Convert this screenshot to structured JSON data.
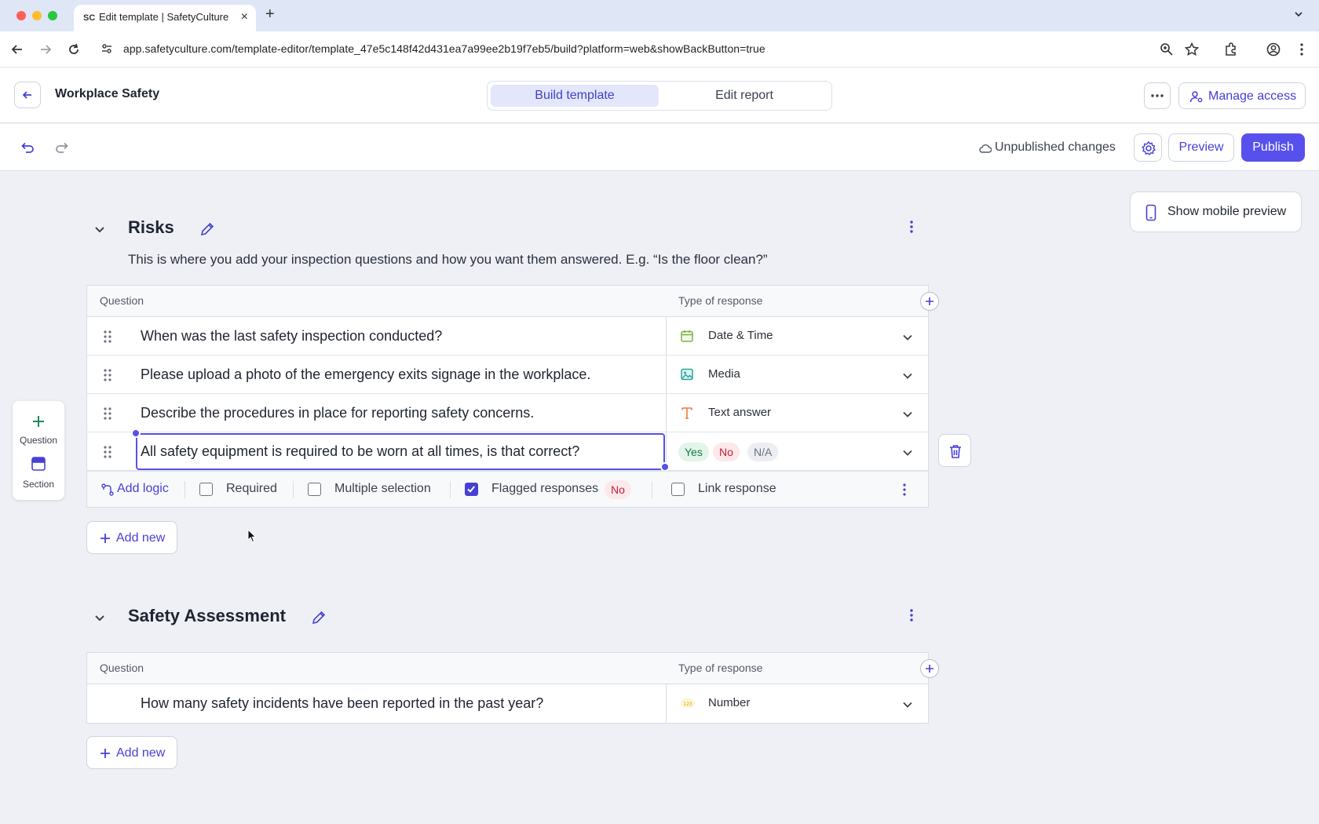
{
  "browser": {
    "tab_title": "Edit template | SafetyCulture",
    "tab_favicon": "SC",
    "url": "app.safetyculture.com/template-editor/template_47e5c148f42d431ea7a99ee2b19f7eb5/build?platform=web&showBackButton=true"
  },
  "header": {
    "title": "Workplace Safety",
    "tabs": [
      {
        "label": "Build template",
        "active": true
      },
      {
        "label": "Edit report",
        "active": false
      }
    ],
    "manage_access_label": "Manage access"
  },
  "toolbar": {
    "status": "Unpublished changes",
    "preview_label": "Preview",
    "publish_label": "Publish"
  },
  "canvas": {
    "mobile_preview_label": "Show mobile preview",
    "add_panel": {
      "question_label": "Question",
      "section_label": "Section"
    }
  },
  "sections": [
    {
      "title": "Risks",
      "description": "This is where you add your inspection questions and how you want them answered. E.g. “Is the floor clean?”",
      "columns": {
        "question": "Question",
        "response": "Type of response"
      },
      "questions": [
        {
          "text": "When was the last safety inspection conducted?",
          "response_type": "Date & Time",
          "icon": "calendar-icon"
        },
        {
          "text": "Please upload a photo of the emergency exits signage in the workplace.",
          "response_type": "Media",
          "icon": "image-icon"
        },
        {
          "text": "Describe the procedures in place for reporting safety concerns.",
          "response_type": "Text answer",
          "icon": "text-icon"
        },
        {
          "text": "All safety equipment is required to be worn at all times, is that correct?",
          "responses": [
            "Yes",
            "No",
            "N/A"
          ],
          "selected": true
        }
      ],
      "options": {
        "add_logic": "Add logic",
        "required": {
          "label": "Required",
          "checked": false
        },
        "multiple_selection": {
          "label": "Multiple selection",
          "checked": false
        },
        "flagged_responses": {
          "label": "Flagged responses",
          "checked": true,
          "value": "No"
        },
        "link_response": {
          "label": "Link response",
          "checked": false
        }
      },
      "add_new_label": "Add new"
    },
    {
      "title": "Safety Assessment",
      "columns": {
        "question": "Question",
        "response": "Type of response"
      },
      "questions": [
        {
          "text": "How many safety incidents have been reported in the past year?",
          "response_type": "Number",
          "icon": "number-icon"
        }
      ],
      "add_new_label": "Add new"
    }
  ],
  "colors": {
    "brand": "#5850ec",
    "link": "#4740d4",
    "yes": "#137a43",
    "no": "#c4203a"
  }
}
